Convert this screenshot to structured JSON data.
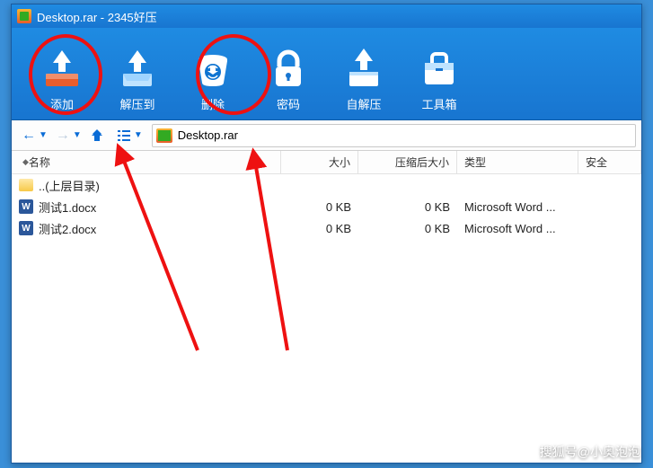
{
  "titlebar": {
    "text": "Desktop.rar - 2345好压"
  },
  "toolbar": {
    "add": "添加",
    "extract": "解压到",
    "delete": "删除",
    "password": "密码",
    "sfx": "自解压",
    "tools": "工具箱"
  },
  "breadcrumb": {
    "path": "Desktop.rar"
  },
  "columns": {
    "name": "名称",
    "size": "大小",
    "csize": "压缩后大小",
    "type": "类型",
    "security": "安全"
  },
  "rows": [
    {
      "name": "..(上层目录)",
      "size": "",
      "csize": "",
      "type": "",
      "icon": "folder"
    },
    {
      "name": "测试1.docx",
      "size": "0 KB",
      "csize": "0 KB",
      "type": "Microsoft Word ...",
      "icon": "docx"
    },
    {
      "name": "测试2.docx",
      "size": "0 KB",
      "csize": "0 KB",
      "type": "Microsoft Word ...",
      "icon": "docx"
    }
  ],
  "watermark": "搜狐号@小奥泡泡"
}
